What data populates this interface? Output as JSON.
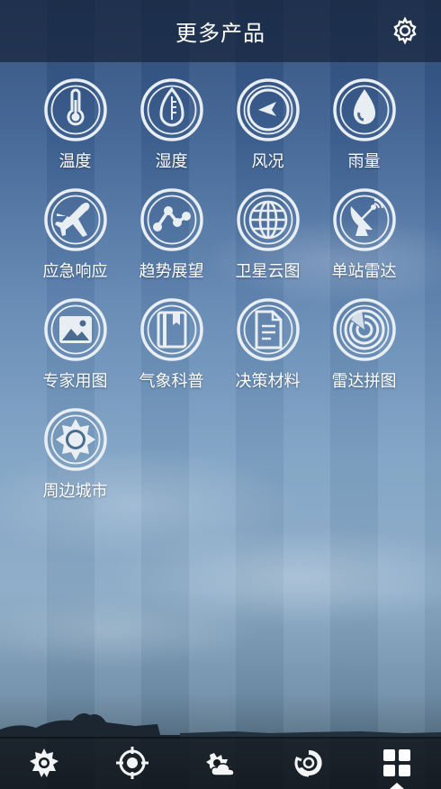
{
  "header": {
    "title": "更多产品",
    "settings_icon": "gear-icon"
  },
  "grid": {
    "items": [
      {
        "label": "温度",
        "icon": "thermometer-icon"
      },
      {
        "label": "湿度",
        "icon": "humidity-gauge-icon"
      },
      {
        "label": "风况",
        "icon": "wind-direction-icon"
      },
      {
        "label": "雨量",
        "icon": "raindrop-icon"
      },
      {
        "label": "应急响应",
        "icon": "airplane-icon"
      },
      {
        "label": "趋势展望",
        "icon": "trend-line-icon"
      },
      {
        "label": "卫星云图",
        "icon": "globe-icon"
      },
      {
        "label": "单站雷达",
        "icon": "radar-dish-icon"
      },
      {
        "label": "专家用图",
        "icon": "picture-icon"
      },
      {
        "label": "气象科普",
        "icon": "book-icon"
      },
      {
        "label": "决策材料",
        "icon": "document-icon"
      },
      {
        "label": "雷达拼图",
        "icon": "radar-mosaic-icon"
      },
      {
        "label": "周边城市",
        "icon": "sun-badge-icon"
      }
    ]
  },
  "tabbar": {
    "tabs": [
      {
        "icon": "sun-icon"
      },
      {
        "icon": "target-icon"
      },
      {
        "icon": "cloud-sun-icon"
      },
      {
        "icon": "typhoon-icon"
      },
      {
        "icon": "grid-icon",
        "selected": true
      }
    ]
  },
  "colors": {
    "header_bg": "#16243a",
    "tabbar_bg": "#0e1218",
    "icon": "#e9eef3"
  }
}
